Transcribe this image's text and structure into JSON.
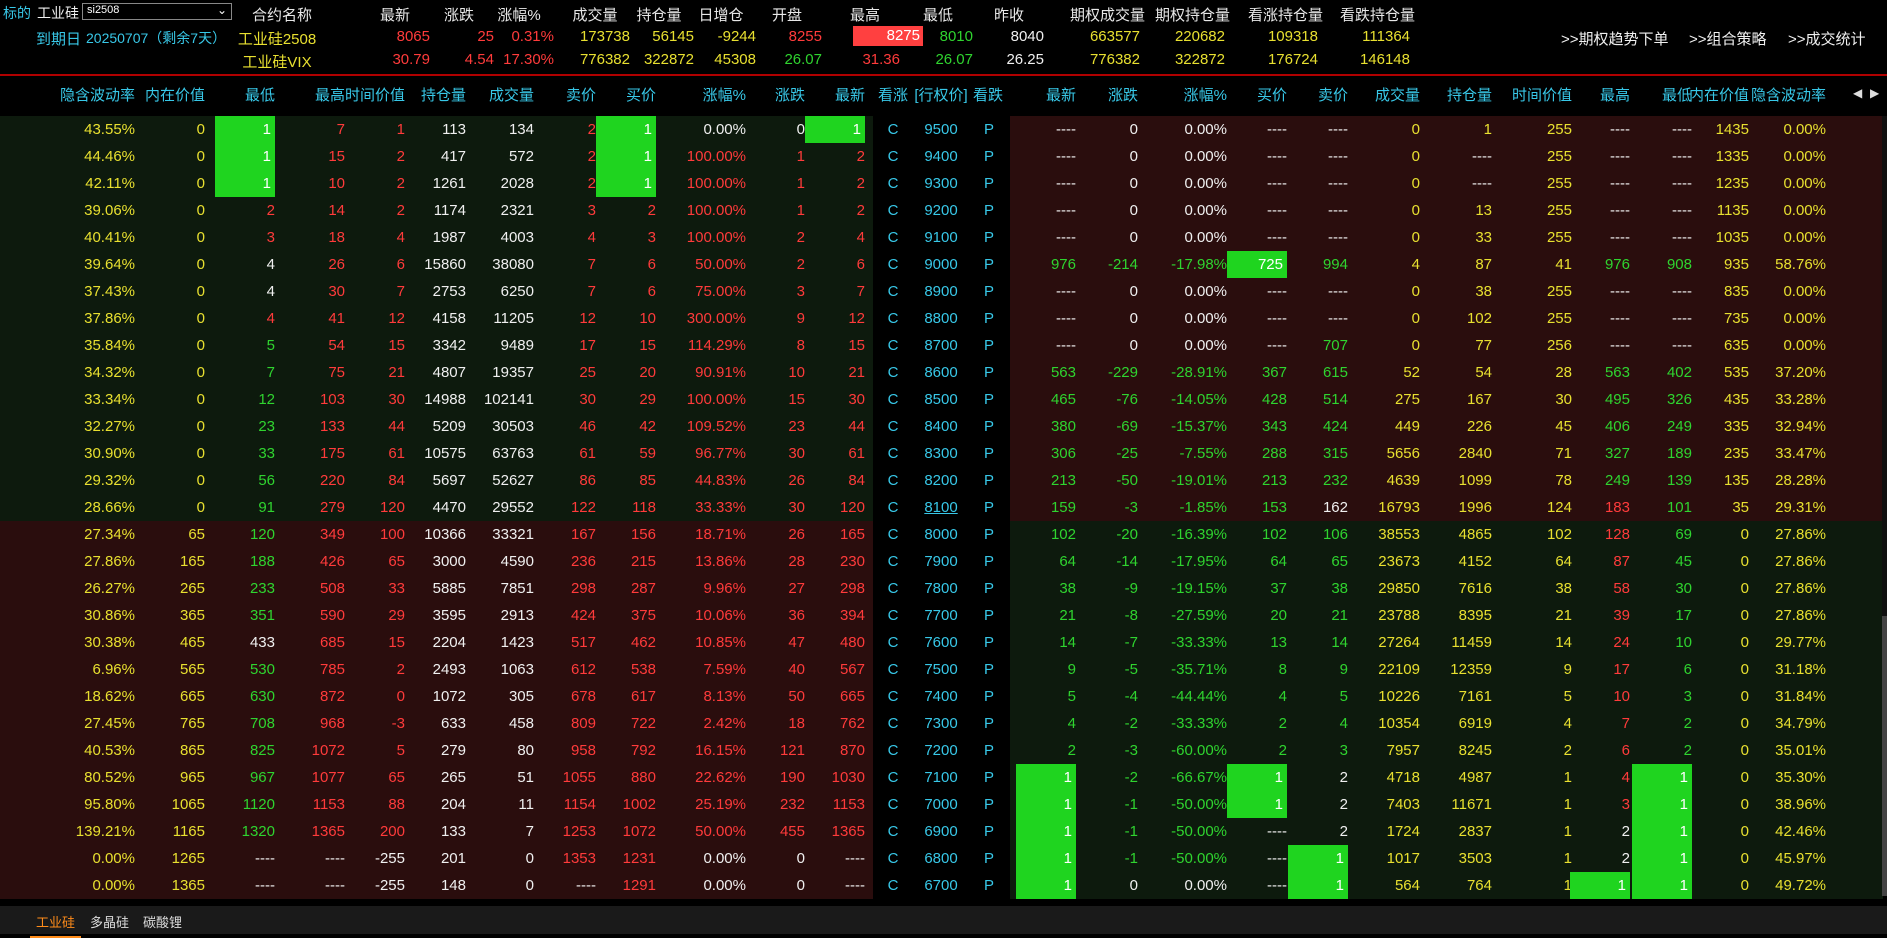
{
  "header": {
    "underlying_label": "标的",
    "underlying_name": "工业硅",
    "symbol": "si2508",
    "expiry_label": "到期日",
    "expiry_date": "20250707（剩余7天）",
    "columns": [
      "合约名称",
      "最新",
      "涨跌",
      "涨幅%",
      "成交量",
      "持仓量",
      "日增仓",
      "开盘",
      "最高",
      "最低",
      "昨收",
      "期权成交量",
      "期权持仓量",
      "看涨持仓量",
      "看跌持仓量"
    ],
    "futures": {
      "name": "工业硅2508",
      "last": "8065",
      "chg": "25",
      "pct": "0.31%",
      "vol": "173738",
      "oi": "56145",
      "doi": "-9244",
      "open": "8255",
      "high": "8275",
      "low": "8010",
      "prev": "8040",
      "opt_vol": "663577",
      "opt_oi": "220682",
      "call_oi": "109318",
      "put_oi": "111364"
    },
    "vix": {
      "name": "工业硅VIX",
      "last": "30.79",
      "chg": "4.54",
      "pct": "17.30%",
      "vol": "776382",
      "oi": "322872",
      "doi": "45308",
      "open": "26.07",
      "high": "31.36",
      "low": "26.07",
      "prev": "26.25",
      "opt_vol": "776382",
      "opt_oi": "322872",
      "call_oi": "176724",
      "put_oi": "146148"
    },
    "buttons": [
      ">>期权趋势下单",
      ">>组合策略",
      ">>成交统计"
    ]
  },
  "table_headers": {
    "call": [
      "隐含波动率",
      "内在价值",
      "最低",
      "最高",
      "时间价值",
      "持仓量",
      "成交量",
      "卖价",
      "买价",
      "涨幅%",
      "涨跌",
      "最新"
    ],
    "mid": [
      "看涨",
      "[行权价]",
      "看跌"
    ],
    "put": [
      "最新",
      "涨跌",
      "涨幅%",
      "买价",
      "卖价",
      "成交量",
      "持仓量",
      "时间价值",
      "最高",
      "最低",
      "内在价值",
      "隐含波动率"
    ],
    "nav_left": "◀",
    "nav_right": "▶"
  },
  "rows": [
    {
      "k": "9500",
      "c": [
        "43.55%",
        "0",
        "1",
        "7",
        "1",
        "113",
        "134",
        "2",
        "1",
        "0.00%",
        "0",
        "1"
      ],
      "p": [
        "----",
        "0",
        "0.00%",
        "----",
        "----",
        "0",
        "1",
        "255",
        "----",
        "----",
        "1435",
        "0.00%"
      ]
    },
    {
      "k": "9400",
      "c": [
        "44.46%",
        "0",
        "1",
        "15",
        "2",
        "417",
        "572",
        "2",
        "1",
        "100.00%",
        "1",
        "2"
      ],
      "p": [
        "----",
        "0",
        "0.00%",
        "----",
        "----",
        "0",
        "----",
        "255",
        "----",
        "----",
        "1335",
        "0.00%"
      ]
    },
    {
      "k": "9300",
      "c": [
        "42.11%",
        "0",
        "1",
        "10",
        "2",
        "1261",
        "2028",
        "2",
        "1",
        "100.00%",
        "1",
        "2"
      ],
      "p": [
        "----",
        "0",
        "0.00%",
        "----",
        "----",
        "0",
        "----",
        "255",
        "----",
        "----",
        "1235",
        "0.00%"
      ]
    },
    {
      "k": "9200",
      "c": [
        "39.06%",
        "0",
        "2",
        "14",
        "2",
        "1174",
        "2321",
        "3",
        "2",
        "100.00%",
        "1",
        "2"
      ],
      "p": [
        "----",
        "0",
        "0.00%",
        "----",
        "----",
        "0",
        "13",
        "255",
        "----",
        "----",
        "1135",
        "0.00%"
      ]
    },
    {
      "k": "9100",
      "c": [
        "40.41%",
        "0",
        "3",
        "18",
        "4",
        "1987",
        "4003",
        "4",
        "3",
        "100.00%",
        "2",
        "4"
      ],
      "p": [
        "----",
        "0",
        "0.00%",
        "----",
        "----",
        "0",
        "33",
        "255",
        "----",
        "----",
        "1035",
        "0.00%"
      ]
    },
    {
      "k": "9000",
      "c": [
        "39.64%",
        "0",
        "4",
        "26",
        "6",
        "15860",
        "38080",
        "7",
        "6",
        "50.00%",
        "2",
        "6"
      ],
      "p": [
        "976",
        "-214",
        "-17.98%",
        "725",
        "994",
        "4",
        "87",
        "41",
        "976",
        "908",
        "935",
        "58.76%"
      ]
    },
    {
      "k": "8900",
      "c": [
        "37.43%",
        "0",
        "4",
        "30",
        "7",
        "2753",
        "6250",
        "7",
        "6",
        "75.00%",
        "3",
        "7"
      ],
      "p": [
        "----",
        "0",
        "0.00%",
        "----",
        "----",
        "0",
        "38",
        "255",
        "----",
        "----",
        "835",
        "0.00%"
      ]
    },
    {
      "k": "8800",
      "c": [
        "37.86%",
        "0",
        "4",
        "41",
        "12",
        "4158",
        "11205",
        "12",
        "10",
        "300.00%",
        "9",
        "12"
      ],
      "p": [
        "----",
        "0",
        "0.00%",
        "----",
        "----",
        "0",
        "102",
        "255",
        "----",
        "----",
        "735",
        "0.00%"
      ]
    },
    {
      "k": "8700",
      "c": [
        "35.84%",
        "0",
        "5",
        "54",
        "15",
        "3342",
        "9489",
        "17",
        "15",
        "114.29%",
        "8",
        "15"
      ],
      "p": [
        "----",
        "0",
        "0.00%",
        "----",
        "707",
        "0",
        "77",
        "256",
        "----",
        "----",
        "635",
        "0.00%"
      ]
    },
    {
      "k": "8600",
      "c": [
        "34.32%",
        "0",
        "7",
        "75",
        "21",
        "4807",
        "19357",
        "25",
        "20",
        "90.91%",
        "10",
        "21"
      ],
      "p": [
        "563",
        "-229",
        "-28.91%",
        "367",
        "615",
        "52",
        "54",
        "28",
        "563",
        "402",
        "535",
        "37.20%"
      ]
    },
    {
      "k": "8500",
      "c": [
        "33.34%",
        "0",
        "12",
        "103",
        "30",
        "14988",
        "102141",
        "30",
        "29",
        "100.00%",
        "15",
        "30"
      ],
      "p": [
        "465",
        "-76",
        "-14.05%",
        "428",
        "514",
        "275",
        "167",
        "30",
        "495",
        "326",
        "435",
        "33.28%"
      ]
    },
    {
      "k": "8400",
      "c": [
        "32.27%",
        "0",
        "23",
        "133",
        "44",
        "5209",
        "30503",
        "46",
        "42",
        "109.52%",
        "23",
        "44"
      ],
      "p": [
        "380",
        "-69",
        "-15.37%",
        "343",
        "424",
        "449",
        "226",
        "45",
        "406",
        "249",
        "335",
        "32.94%"
      ]
    },
    {
      "k": "8300",
      "c": [
        "30.90%",
        "0",
        "33",
        "175",
        "61",
        "10575",
        "63763",
        "61",
        "59",
        "96.77%",
        "30",
        "61"
      ],
      "p": [
        "306",
        "-25",
        "-7.55%",
        "288",
        "315",
        "5656",
        "2840",
        "71",
        "327",
        "189",
        "235",
        "33.47%"
      ]
    },
    {
      "k": "8200",
      "c": [
        "29.32%",
        "0",
        "56",
        "220",
        "84",
        "5697",
        "52627",
        "86",
        "85",
        "44.83%",
        "26",
        "84"
      ],
      "p": [
        "213",
        "-50",
        "-19.01%",
        "213",
        "232",
        "4639",
        "1099",
        "78",
        "249",
        "139",
        "135",
        "28.28%"
      ]
    },
    {
      "k": "8100",
      "c": [
        "28.66%",
        "0",
        "91",
        "279",
        "120",
        "4470",
        "29552",
        "122",
        "118",
        "33.33%",
        "30",
        "120"
      ],
      "p": [
        "159",
        "-3",
        "-1.85%",
        "153",
        "162",
        "16793",
        "1996",
        "124",
        "183",
        "101",
        "35",
        "29.31%"
      ]
    },
    {
      "k": "8000",
      "c": [
        "27.34%",
        "65",
        "120",
        "349",
        "100",
        "10366",
        "33321",
        "167",
        "156",
        "18.71%",
        "26",
        "165"
      ],
      "p": [
        "102",
        "-20",
        "-16.39%",
        "102",
        "106",
        "38553",
        "4865",
        "102",
        "128",
        "69",
        "0",
        "27.86%"
      ]
    },
    {
      "k": "7900",
      "c": [
        "27.86%",
        "165",
        "188",
        "426",
        "65",
        "3000",
        "4590",
        "236",
        "215",
        "13.86%",
        "28",
        "230"
      ],
      "p": [
        "64",
        "-14",
        "-17.95%",
        "64",
        "65",
        "23673",
        "4152",
        "64",
        "87",
        "45",
        "0",
        "27.86%"
      ]
    },
    {
      "k": "7800",
      "c": [
        "26.27%",
        "265",
        "233",
        "508",
        "33",
        "5885",
        "7851",
        "298",
        "287",
        "9.96%",
        "27",
        "298"
      ],
      "p": [
        "38",
        "-9",
        "-19.15%",
        "37",
        "38",
        "29850",
        "7616",
        "38",
        "58",
        "30",
        "0",
        "27.86%"
      ]
    },
    {
      "k": "7700",
      "c": [
        "30.86%",
        "365",
        "351",
        "590",
        "29",
        "3595",
        "2913",
        "424",
        "375",
        "10.06%",
        "36",
        "394"
      ],
      "p": [
        "21",
        "-8",
        "-27.59%",
        "20",
        "21",
        "23788",
        "8395",
        "21",
        "39",
        "17",
        "0",
        "27.86%"
      ]
    },
    {
      "k": "7600",
      "c": [
        "30.38%",
        "465",
        "433",
        "685",
        "15",
        "2204",
        "1423",
        "517",
        "462",
        "10.85%",
        "47",
        "480"
      ],
      "p": [
        "14",
        "-7",
        "-33.33%",
        "13",
        "14",
        "27264",
        "11459",
        "14",
        "24",
        "10",
        "0",
        "29.77%"
      ]
    },
    {
      "k": "7500",
      "c": [
        "6.96%",
        "565",
        "530",
        "785",
        "2",
        "2493",
        "1063",
        "612",
        "538",
        "7.59%",
        "40",
        "567"
      ],
      "p": [
        "9",
        "-5",
        "-35.71%",
        "8",
        "9",
        "22109",
        "12359",
        "9",
        "17",
        "6",
        "0",
        "31.18%"
      ]
    },
    {
      "k": "7400",
      "c": [
        "18.62%",
        "665",
        "630",
        "872",
        "0",
        "1072",
        "305",
        "678",
        "617",
        "8.13%",
        "50",
        "665"
      ],
      "p": [
        "5",
        "-4",
        "-44.44%",
        "4",
        "5",
        "10226",
        "7161",
        "5",
        "10",
        "3",
        "0",
        "31.84%"
      ]
    },
    {
      "k": "7300",
      "c": [
        "27.45%",
        "765",
        "708",
        "968",
        "-3",
        "633",
        "458",
        "809",
        "722",
        "2.42%",
        "18",
        "762"
      ],
      "p": [
        "4",
        "-2",
        "-33.33%",
        "2",
        "4",
        "10354",
        "6919",
        "4",
        "7",
        "2",
        "0",
        "34.79%"
      ]
    },
    {
      "k": "7200",
      "c": [
        "40.53%",
        "865",
        "825",
        "1072",
        "5",
        "279",
        "80",
        "958",
        "792",
        "16.15%",
        "121",
        "870"
      ],
      "p": [
        "2",
        "-3",
        "-60.00%",
        "2",
        "3",
        "7957",
        "8245",
        "2",
        "6",
        "2",
        "0",
        "35.01%"
      ]
    },
    {
      "k": "7100",
      "c": [
        "80.52%",
        "965",
        "967",
        "1077",
        "65",
        "265",
        "51",
        "1055",
        "880",
        "22.62%",
        "190",
        "1030"
      ],
      "p": [
        "1",
        "-2",
        "-66.67%",
        "1",
        "2",
        "4718",
        "4987",
        "1",
        "4",
        "1",
        "0",
        "35.30%"
      ]
    },
    {
      "k": "7000",
      "c": [
        "95.80%",
        "1065",
        "1120",
        "1153",
        "88",
        "204",
        "11",
        "1154",
        "1002",
        "25.19%",
        "232",
        "1153"
      ],
      "p": [
        "1",
        "-1",
        "-50.00%",
        "1",
        "2",
        "7403",
        "11671",
        "1",
        "3",
        "1",
        "0",
        "38.96%"
      ]
    },
    {
      "k": "6900",
      "c": [
        "139.21%",
        "1165",
        "1320",
        "1365",
        "200",
        "133",
        "7",
        "1253",
        "1072",
        "50.00%",
        "455",
        "1365"
      ],
      "p": [
        "1",
        "-1",
        "-50.00%",
        "----",
        "2",
        "1724",
        "2837",
        "1",
        "2",
        "1",
        "0",
        "42.46%"
      ]
    },
    {
      "k": "6800",
      "c": [
        "0.00%",
        "1265",
        "----",
        "----",
        "-255",
        "201",
        "0",
        "1353",
        "1231",
        "0.00%",
        "0",
        "----"
      ],
      "p": [
        "1",
        "-1",
        "-50.00%",
        "----",
        "1",
        "1017",
        "3503",
        "1",
        "2",
        "1",
        "0",
        "45.97%"
      ]
    },
    {
      "k": "6700",
      "c": [
        "0.00%",
        "1365",
        "----",
        "----",
        "-255",
        "148",
        "0",
        "----",
        "1291",
        "0.00%",
        "0",
        "----"
      ],
      "p": [
        "1",
        "0",
        "0.00%",
        "----",
        "1",
        "564",
        "764",
        "1",
        "1",
        "1",
        "0",
        "49.72%"
      ]
    }
  ],
  "call_side_letter": "C",
  "put_side_letter": "P",
  "tabs": [
    "工业硅",
    "多晶硅",
    "碳酸锂"
  ],
  "colors": {
    "red": "#ff3b3b",
    "green": "#2fd42f",
    "yellow": "#e8e030",
    "cyan": "#38c8e8",
    "highlight": "#1fd41f",
    "itm_bg": "#2a0d0d",
    "otm_bg": "#0d1a0d"
  }
}
